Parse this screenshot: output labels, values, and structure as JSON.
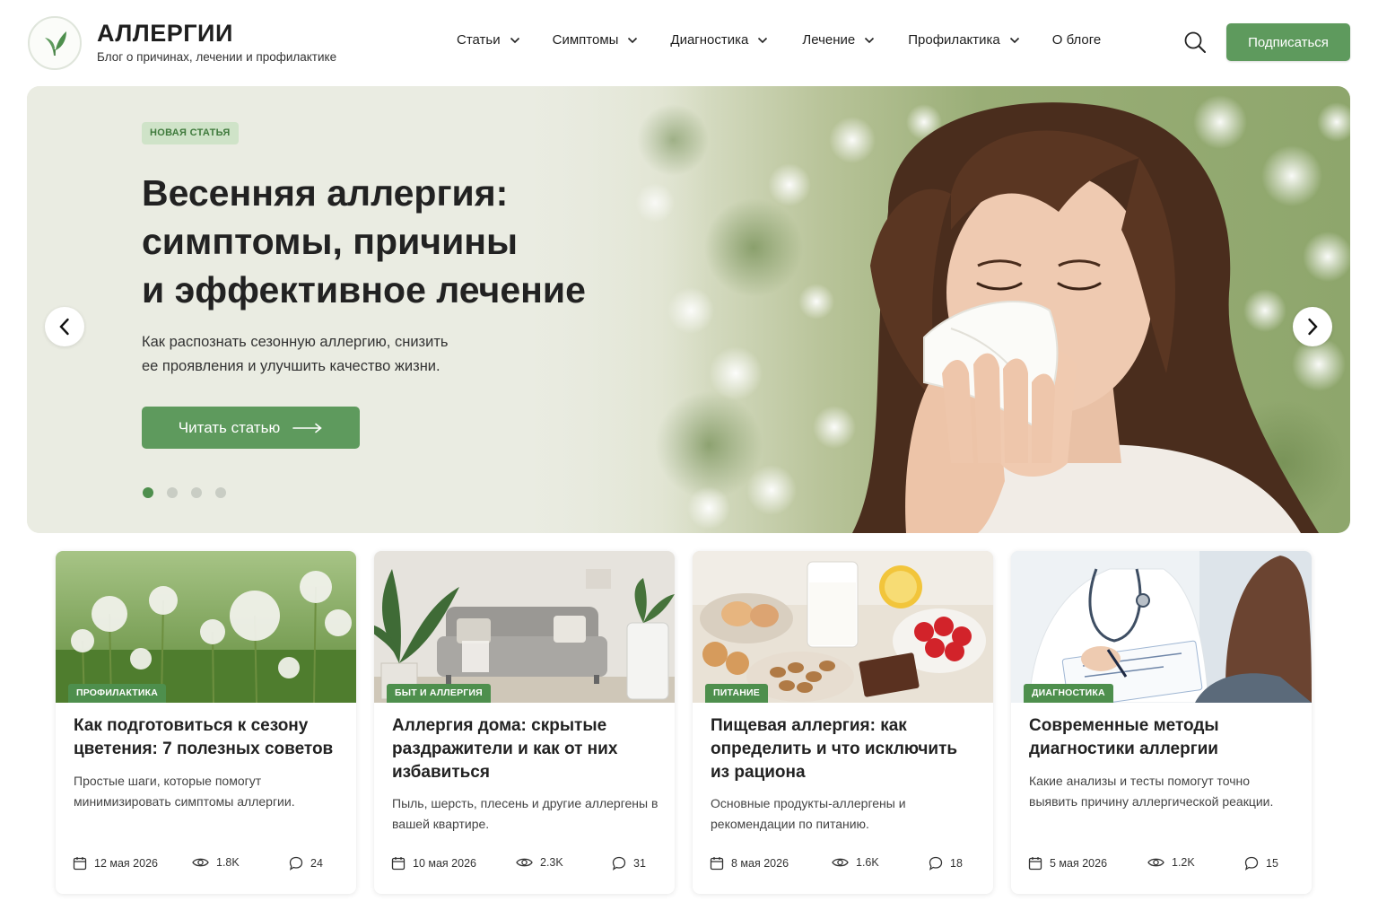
{
  "brand": {
    "title": "АЛЛЕРГИИ",
    "subtitle": "Блог о причинах, лечении и профилактике",
    "logo_icon": "leaf-icon",
    "accent": "#5e9a5d"
  },
  "nav": {
    "items": [
      {
        "label": "Статьи",
        "has_dropdown": true
      },
      {
        "label": "Симптомы",
        "has_dropdown": true
      },
      {
        "label": "Диагностика",
        "has_dropdown": true
      },
      {
        "label": "Лечение",
        "has_dropdown": true
      },
      {
        "label": "Профилактика",
        "has_dropdown": true
      },
      {
        "label": "О блоге",
        "has_dropdown": false
      }
    ],
    "search_icon": "search-icon",
    "subscribe_label": "Подписаться"
  },
  "hero": {
    "badge": "НОВАЯ СТАТЬЯ",
    "title_lines": [
      "Весенняя аллергия:",
      "симптомы, причины",
      "и эффективное лечение"
    ],
    "description_lines": [
      "Как распознать сезонную аллергию, снизить",
      "ее проявления и улучшить качество жизни."
    ],
    "cta_label": "Читать статью",
    "slides_total": 4,
    "active_slide": 1
  },
  "cards": [
    {
      "tag": "ПРОФИЛАКТИКА",
      "title": "Как подготовиться к сезону цветения: 7 полезных советов",
      "description": "Простые шаги, которые помогут минимизировать симптомы аллергии.",
      "date": "12 мая 2026",
      "views": "1.8K",
      "comments": "24",
      "image": "dandelions"
    },
    {
      "tag": "БЫТ И АЛЛЕРГИЯ",
      "title": "Аллергия дома: скрытые раздражители и как от них избавиться",
      "description": "Пыль, шерсть, плесень и другие аллергены в вашей квартире.",
      "date": "10 мая 2026",
      "views": "2.3K",
      "comments": "31",
      "image": "living-room"
    },
    {
      "tag": "ПИТАНИЕ",
      "title": "Пищевая аллергия: как определить и что исключить из рациона",
      "description": "Основные продукты-аллергены и рекомендации по питанию.",
      "date": "8 мая 2026",
      "views": "1.6K",
      "comments": "18",
      "image": "food"
    },
    {
      "tag": "ДИАГНОСТИКА",
      "title": "Современные методы диагностики аллергии",
      "description": "Какие анализы и тесты помогут точно выявить причину аллергической реакции.",
      "date": "5 мая 2026",
      "views": "1.2K",
      "comments": "15",
      "image": "doctor"
    }
  ]
}
